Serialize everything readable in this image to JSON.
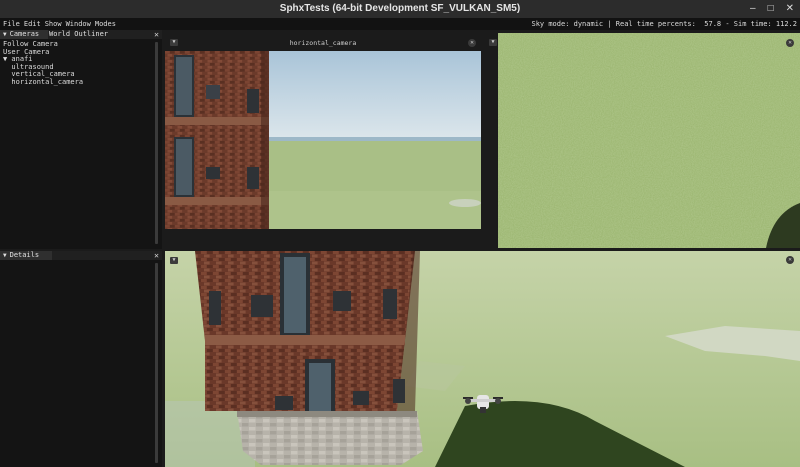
{
  "window": {
    "title": "SphxTests (64-bit Development SF_VULKAN_SM5)",
    "minimize_glyph": "–",
    "maximize_glyph": "□",
    "close_glyph": "✕"
  },
  "menubar": {
    "items": [
      "File",
      "Edit",
      "Show",
      "Window",
      "Modes"
    ],
    "status": "Sky mode: dynamic | Real time percents:  57.8 - Sim time: 112.2"
  },
  "left_panel": {
    "tabs": [
      "Cameras",
      "World Outliner"
    ],
    "close_glyph": "✕",
    "tree": [
      "Follow Camera",
      "User Camera",
      "▼ anafi",
      "  ultrasound",
      "  vertical_camera",
      "  horizontal_camera"
    ]
  },
  "details_panel": {
    "tab": "Details",
    "close_glyph": "✕"
  },
  "viewports": {
    "horizontal": {
      "title": "horizontal_camera",
      "toggle": "▼",
      "close": "✕"
    },
    "vertical": {
      "toggle": "▼",
      "close": "✕"
    },
    "main": {
      "toggle": "▼",
      "close": "✕"
    }
  },
  "colors": {
    "sky_top": "#a9c4d8",
    "sky_bottom": "#d7e4ea",
    "grass": "#a6bd82",
    "brick": "#6b3a2a",
    "bg": "#141414"
  }
}
